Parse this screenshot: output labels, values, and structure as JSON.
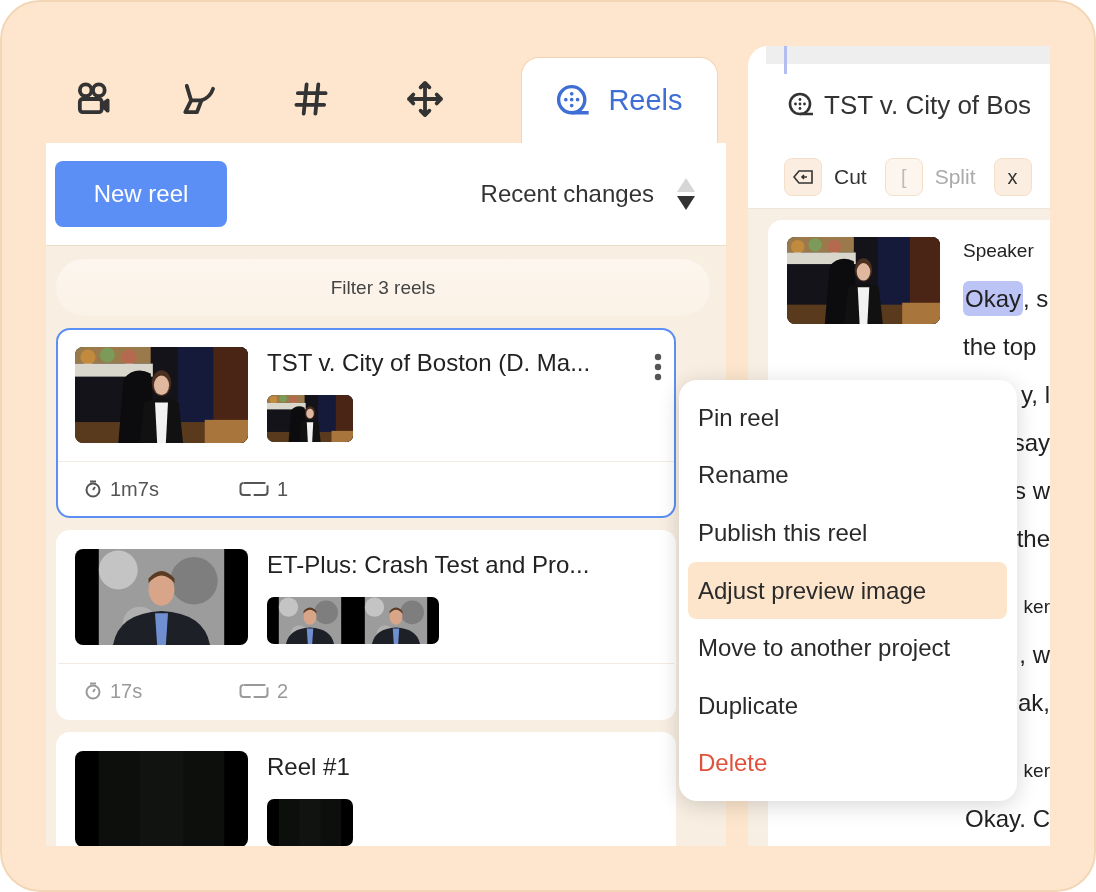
{
  "tabs": [
    {
      "selected": false
    },
    {
      "selected": false
    },
    {
      "selected": false
    },
    {
      "selected": false
    },
    {
      "label": "Reels",
      "selected": true
    }
  ],
  "actions": {
    "new_button": "New reel",
    "sort_label": "Recent changes"
  },
  "filter": {
    "placeholder": "Filter 3 reels"
  },
  "reels": [
    {
      "title": "TST v. City of Boston (D. Ma...",
      "selected": true,
      "duration": "1m7s",
      "clips": "1"
    },
    {
      "title": "ET-Plus: Crash Test and Pro...",
      "selected": false,
      "duration": "17s",
      "clips": "2"
    },
    {
      "title": "Reel #1",
      "selected": false
    }
  ],
  "menu": {
    "items": [
      {
        "label": "Pin reel",
        "selected": false,
        "kind": "normal"
      },
      {
        "label": "Rename",
        "selected": false,
        "kind": "normal"
      },
      {
        "label": "Publish this reel",
        "selected": false,
        "kind": "normal"
      },
      {
        "label": "Adjust preview image",
        "selected": true,
        "kind": "normal"
      },
      {
        "label": "Move to another project",
        "selected": false,
        "kind": "normal"
      },
      {
        "label": "Duplicate",
        "selected": false,
        "kind": "normal"
      },
      {
        "label": "Delete",
        "selected": false,
        "kind": "danger"
      }
    ]
  },
  "editor": {
    "title": "TST v. City of Bos",
    "shortcuts": [
      {
        "label": "Cut",
        "disabled": false
      },
      {
        "key": "[",
        "label": "Split",
        "disabled": true
      },
      {
        "key": "x",
        "disabled": false
      }
    ],
    "transcript": [
      {
        "kind": "speaker",
        "text": "Speaker"
      },
      {
        "kind": "line",
        "highlight": "Okay",
        "text": ", s"
      },
      {
        "kind": "line",
        "text": "the top"
      },
      {
        "kind": "line",
        "text": "y, l"
      },
      {
        "kind": "line",
        "text": "say"
      },
      {
        "kind": "line",
        "text": "s w"
      },
      {
        "kind": "line",
        "text": "the"
      },
      {
        "kind": "speaker",
        "text": "ker"
      },
      {
        "kind": "line",
        "text": ", w"
      },
      {
        "kind": "line",
        "text": "ak,"
      },
      {
        "kind": "speaker",
        "text": "ker"
      },
      {
        "kind": "line",
        "text": "Okay. C"
      }
    ]
  }
}
